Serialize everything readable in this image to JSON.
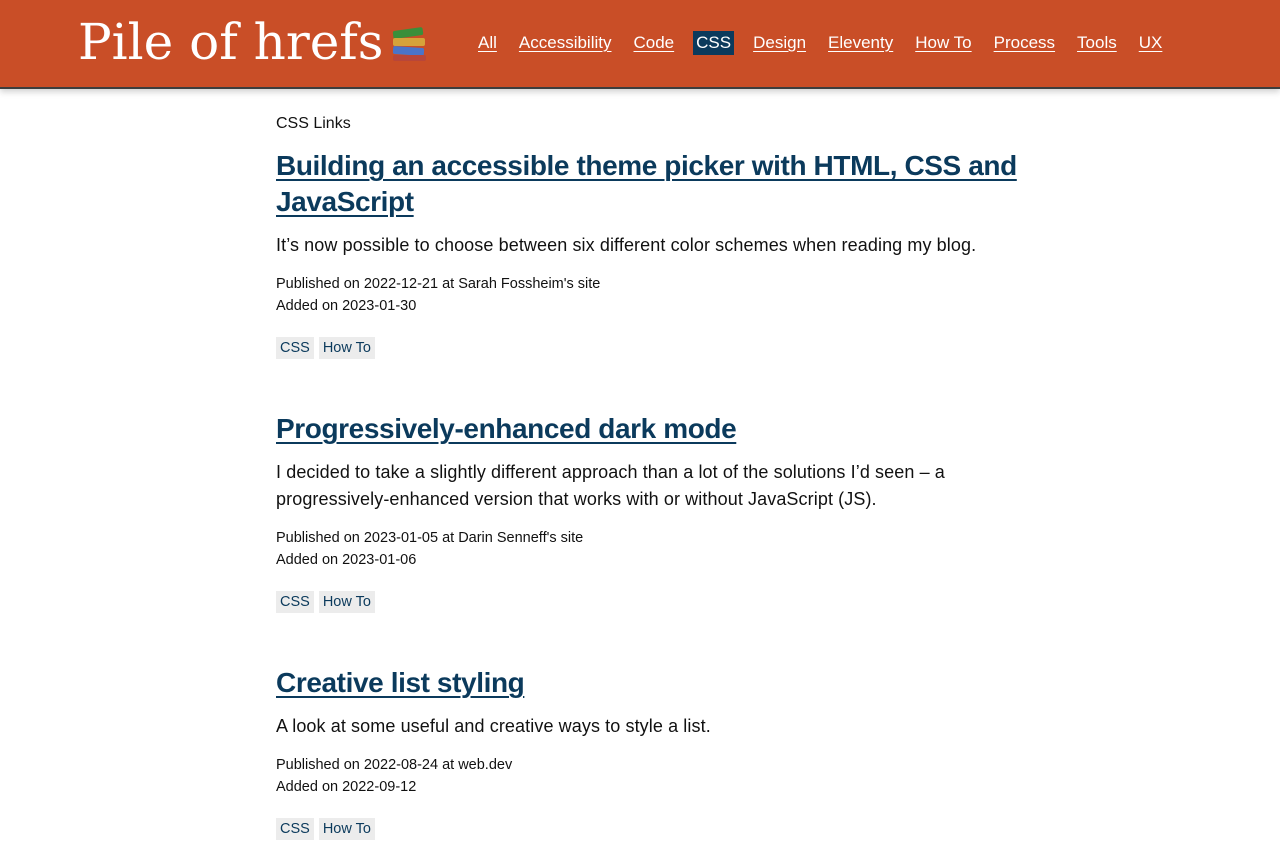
{
  "header": {
    "logo_text": "Pile of hrefs",
    "logo_icon": "books-icon",
    "bg_color": "#c94e27",
    "active_color": "#0b3a5c",
    "nav": [
      {
        "label": "All",
        "active": false
      },
      {
        "label": "Accessibility",
        "active": false
      },
      {
        "label": "Code",
        "active": false
      },
      {
        "label": "CSS",
        "active": true
      },
      {
        "label": "Design",
        "active": false
      },
      {
        "label": "Eleventy",
        "active": false
      },
      {
        "label": "How To",
        "active": false
      },
      {
        "label": "Process",
        "active": false
      },
      {
        "label": "Tools",
        "active": false
      },
      {
        "label": "UX",
        "active": false
      }
    ]
  },
  "main": {
    "section_label": "CSS Links",
    "posts": [
      {
        "title": "Building an accessible theme picker with HTML, CSS and JavaScript",
        "description": "It’s now possible to choose between six different color schemes when reading my blog.",
        "published": "Published on 2022-12-21 at Sarah Fossheim's site",
        "added": "Added on 2023-01-30",
        "tags": [
          "CSS",
          "How To"
        ]
      },
      {
        "title": "Progressively-enhanced dark mode",
        "description": "I decided to take a slightly different approach than a lot of the solutions I’d seen – a progressively-enhanced version that works with or without JavaScript (JS).",
        "published": "Published on 2023-01-05 at Darin Senneff's site",
        "added": "Added on 2023-01-06",
        "tags": [
          "CSS",
          "How To"
        ]
      },
      {
        "title": "Creative list styling",
        "description": "A look at some useful and creative ways to style a list.",
        "published": "Published on 2022-08-24 at web.dev",
        "added": "Added on 2022-09-12",
        "tags": [
          "CSS",
          "How To"
        ]
      }
    ]
  }
}
